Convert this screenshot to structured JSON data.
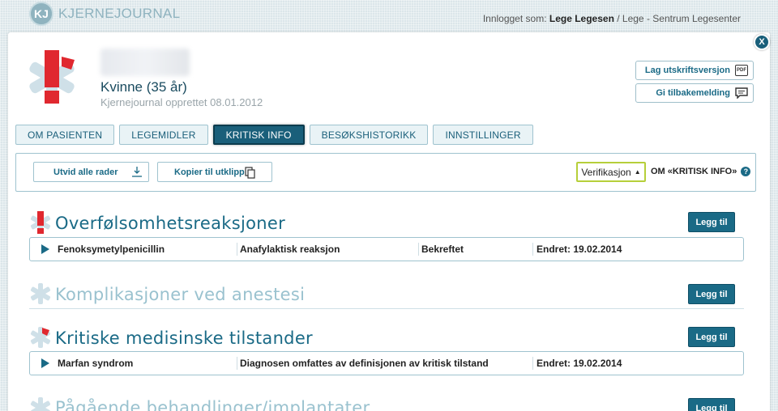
{
  "app": {
    "logo_letters": "KJ",
    "logo_text": "KJERNEJOURNAL"
  },
  "login": {
    "prefix": "Innlogget som: ",
    "user": "Lege Legesen",
    "suffix": " / Lege - Sentrum Legesenter"
  },
  "close_label": "X",
  "patient": {
    "gender_age": "Kvinne (35 år)",
    "created": "Kjernejournal opprettet 08.01.2012"
  },
  "side_buttons": {
    "print": "Lag utskriftsversjon",
    "print_icon_text": "PDF",
    "feedback": "Gi tilbakemelding"
  },
  "tabs": [
    {
      "label": "OM PASIENTEN"
    },
    {
      "label": "LEGEMIDLER"
    },
    {
      "label": "KRITISK INFO"
    },
    {
      "label": "BESØKSHISTORIKK"
    },
    {
      "label": "INNSTILLINGER"
    }
  ],
  "toolbar": {
    "expand": "Utvid alle rader",
    "copy": "Kopier til utklipp",
    "verification": "Verifikasjon",
    "about": "OM «KRITISK INFO»"
  },
  "sections": [
    {
      "title": "Overfølsomhetsreaksjoner",
      "add": "Legg til",
      "row": {
        "c1": "Fenoksymetylpenicillin",
        "c2": "Anafylaktisk reaksjon",
        "c3": "Bekreftet",
        "c4": "Endret: 19.02.2014"
      }
    },
    {
      "title": "Komplikasjoner ved anestesi",
      "add": "Legg til"
    },
    {
      "title": "Kritiske medisinske tilstander",
      "add": "Legg til",
      "row": {
        "c1": "Marfan syndrom",
        "c2": "Diagnosen omfattes av definisjonen av kritisk tilstand",
        "c4": "Endret: 19.02.2014"
      }
    },
    {
      "title": "Pågående behandlinger/implantater",
      "add": "Legg til"
    }
  ],
  "colors": {
    "primary": "#1a6a86",
    "critical_red": "#e0282f",
    "muted_teal": "#9ac2cf",
    "verify_green": "#b6cf3a"
  }
}
